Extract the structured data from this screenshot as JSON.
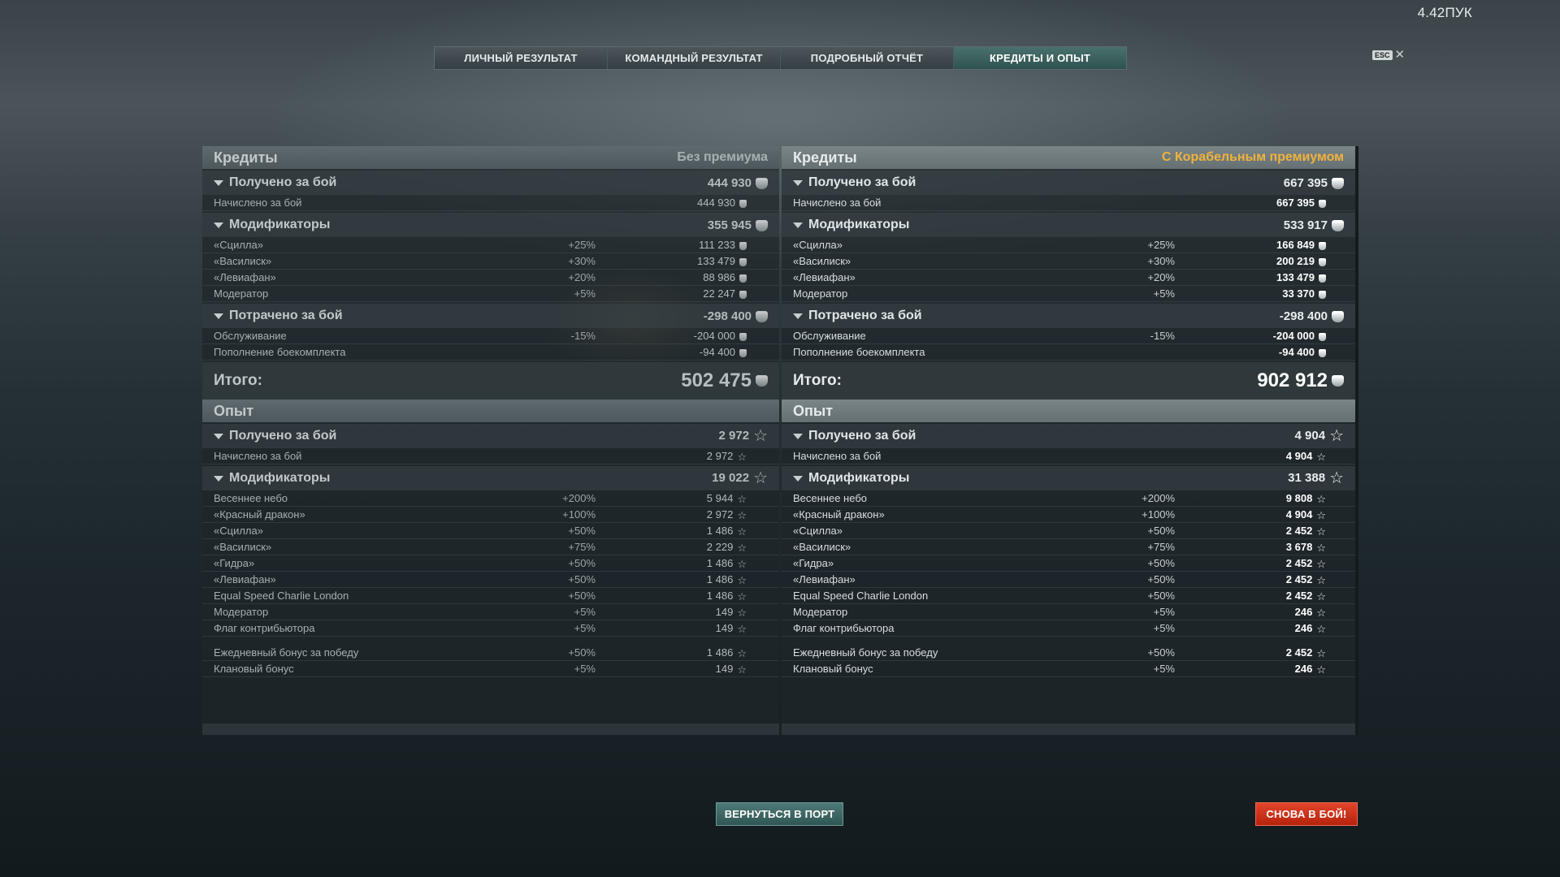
{
  "fps": "4.42ПУК",
  "tabs": [
    {
      "label": "ЛИЧНЫЙ РЕЗУЛЬТАТ"
    },
    {
      "label": "КОМАНДНЫЙ РЕЗУЛЬТАТ"
    },
    {
      "label": "ПОДРОБНЫЙ ОТЧЁТ"
    },
    {
      "label": "КРЕДИТЫ И ОПЫТ"
    }
  ],
  "esc_label": "ESC",
  "close_glyph": "✕",
  "left": {
    "credits": {
      "title": "Кредиты",
      "subtitle": "Без премиума",
      "earned": {
        "label": "Получено за бой",
        "value": "444 930",
        "rows": [
          {
            "label": "Начислено за бой",
            "pct": "",
            "value": "444 930"
          }
        ]
      },
      "modifiers": {
        "label": "Модификаторы",
        "value": "355 945",
        "rows": [
          {
            "label": "«Сцилла»",
            "pct": "+25%",
            "value": "111 233"
          },
          {
            "label": "«Василиск»",
            "pct": "+30%",
            "value": "133 479"
          },
          {
            "label": "«Левиафан»",
            "pct": "+20%",
            "value": "88 986"
          },
          {
            "label": "Модератор",
            "pct": "+5%",
            "value": "22 247"
          }
        ]
      },
      "spent": {
        "label": "Потрачено за бой",
        "value": "-298 400",
        "rows": [
          {
            "label": "Обслуживание",
            "pct": "-15%",
            "value": "-204 000"
          },
          {
            "label": "Пополнение боекомплекта",
            "pct": "",
            "value": "-94 400"
          }
        ]
      },
      "total_label": "Итого:",
      "total_value": "502 475"
    },
    "xp": {
      "title": "Опыт",
      "earned": {
        "label": "Получено за бой",
        "value": "2 972",
        "rows": [
          {
            "label": "Начислено за бой",
            "pct": "",
            "value": "2 972"
          }
        ]
      },
      "modifiers": {
        "label": "Модификаторы",
        "value": "19 022",
        "rows": [
          {
            "label": "Весеннее небо",
            "pct": "+200%",
            "value": "5 944"
          },
          {
            "label": "«Красный дракон»",
            "pct": "+100%",
            "value": "2 972"
          },
          {
            "label": "«Сцилла»",
            "pct": "+50%",
            "value": "1 486"
          },
          {
            "label": "«Василиск»",
            "pct": "+75%",
            "value": "2 229"
          },
          {
            "label": "«Гидра»",
            "pct": "+50%",
            "value": "1 486"
          },
          {
            "label": "«Левиафан»",
            "pct": "+50%",
            "value": "1 486"
          },
          {
            "label": "Equal Speed Charlie London",
            "pct": "+50%",
            "value": "1 486"
          },
          {
            "label": "Модератор",
            "pct": "+5%",
            "value": "149"
          },
          {
            "label": "Флаг контрибьютора",
            "pct": "+5%",
            "value": "149"
          }
        ]
      },
      "extra_rows": [
        {
          "label": "Ежедневный бонус за победу",
          "pct": "+50%",
          "value": "1 486"
        },
        {
          "label": "Клановый бонус",
          "pct": "+5%",
          "value": "149"
        }
      ]
    }
  },
  "right": {
    "credits": {
      "title": "Кредиты",
      "subtitle": "С Корабельным премиумом",
      "earned": {
        "label": "Получено за бой",
        "value": "667 395",
        "rows": [
          {
            "label": "Начислено за бой",
            "pct": "",
            "value": "667 395"
          }
        ]
      },
      "modifiers": {
        "label": "Модификаторы",
        "value": "533 917",
        "rows": [
          {
            "label": "«Сцилла»",
            "pct": "+25%",
            "value": "166 849"
          },
          {
            "label": "«Василиск»",
            "pct": "+30%",
            "value": "200 219"
          },
          {
            "label": "«Левиафан»",
            "pct": "+20%",
            "value": "133 479"
          },
          {
            "label": "Модератор",
            "pct": "+5%",
            "value": "33 370"
          }
        ]
      },
      "spent": {
        "label": "Потрачено за бой",
        "value": "-298 400",
        "rows": [
          {
            "label": "Обслуживание",
            "pct": "-15%",
            "value": "-204 000"
          },
          {
            "label": "Пополнение боекомплекта",
            "pct": "",
            "value": "-94 400"
          }
        ]
      },
      "total_label": "Итого:",
      "total_value": "902 912"
    },
    "xp": {
      "title": "Опыт",
      "earned": {
        "label": "Получено за бой",
        "value": "4 904",
        "rows": [
          {
            "label": "Начислено за бой",
            "pct": "",
            "value": "4 904"
          }
        ]
      },
      "modifiers": {
        "label": "Модификаторы",
        "value": "31 388",
        "rows": [
          {
            "label": "Весеннее небо",
            "pct": "+200%",
            "value": "9 808"
          },
          {
            "label": "«Красный дракон»",
            "pct": "+100%",
            "value": "4 904"
          },
          {
            "label": "«Сцилла»",
            "pct": "+50%",
            "value": "2 452"
          },
          {
            "label": "«Василиск»",
            "pct": "+75%",
            "value": "3 678"
          },
          {
            "label": "«Гидра»",
            "pct": "+50%",
            "value": "2 452"
          },
          {
            "label": "«Левиафан»",
            "pct": "+50%",
            "value": "2 452"
          },
          {
            "label": "Equal Speed Charlie London",
            "pct": "+50%",
            "value": "2 452"
          },
          {
            "label": "Модератор",
            "pct": "+5%",
            "value": "246"
          },
          {
            "label": "Флаг контрибьютора",
            "pct": "+5%",
            "value": "246"
          }
        ]
      },
      "extra_rows": [
        {
          "label": "Ежедневный бонус за победу",
          "pct": "+50%",
          "value": "2 452"
        },
        {
          "label": "Клановый бонус",
          "pct": "+5%",
          "value": "246"
        }
      ]
    }
  },
  "buttons": {
    "port": "ВЕРНУТЬСЯ В ПОРТ",
    "battle": "СНОВА В БОЙ!"
  },
  "icons": {
    "credits": "credits-coin-icon",
    "xp": "xp-star-icon",
    "collapse": "collapse-arrow-icon",
    "close": "close-icon"
  },
  "colors": {
    "premium_accent": "#f0b23c",
    "active_tab": "#2f524f",
    "battle_button": "#c72d12",
    "port_button": "#3c6360"
  }
}
